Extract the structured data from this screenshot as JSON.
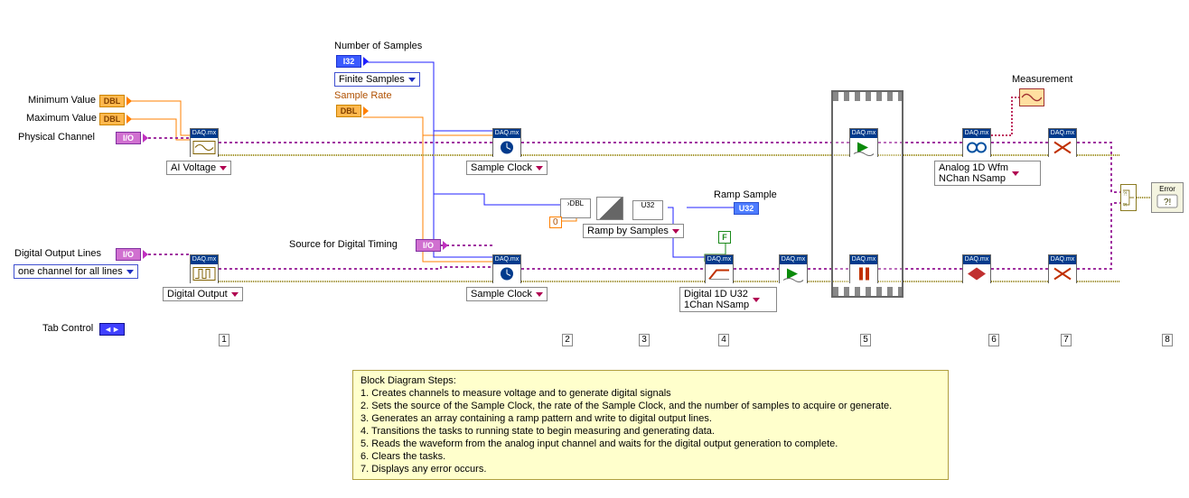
{
  "labels": {
    "min_value": "Minimum Value",
    "max_value": "Maximum Value",
    "phys_chan": "Physical Channel",
    "num_samples": "Number of Samples",
    "finite_samples": "Finite Samples",
    "sample_rate": "Sample Rate",
    "dig_out_lines": "Digital Output Lines",
    "one_chan_all": "one channel for all lines",
    "src_dig_timing": "Source for Digital Timing",
    "ramp_sample": "Ramp Sample",
    "measurement": "Measurement",
    "tab_control": "Tab Control"
  },
  "polysel": {
    "ai_voltage": "AI Voltage",
    "digital_output": "Digital Output",
    "sample_clock_top": "Sample Clock",
    "sample_clock_bot": "Sample Clock",
    "ramp_by_samples": "Ramp by Samples",
    "digital_1d_u32": "Digital 1D U32\n1Chan NSamp",
    "analog_1d_wfm": "Analog 1D Wfm\nNChan NSamp"
  },
  "types": {
    "dbl": "DBL",
    "i32": "I32",
    "u32": "U32",
    "io": "I/O",
    "tab": "◄►"
  },
  "const": {
    "zero": "0",
    "false": "F",
    "dbl_cast": "›DBL"
  },
  "daqmx_header": "DAQ.mx",
  "steps": [
    "1",
    "2",
    "3",
    "4",
    "5",
    "6",
    "7",
    "8"
  ],
  "comment": "Block Diagram Steps:\n1. Creates channels to measure voltage and to generate digital signals\n2. Sets the source of the Sample Clock, the rate of the Sample Clock, and the number of samples to acquire or generate.\n3. Generates an array containing a ramp pattern and write to digital output lines.\n4. Transitions the tasks to running state to begin measuring and generating data.\n5. Reads the waveform from the analog input channel and waits for the digital output generation to complete.\n6. Clears the tasks.\n7. Displays any error occurs.",
  "error_label": "Error"
}
